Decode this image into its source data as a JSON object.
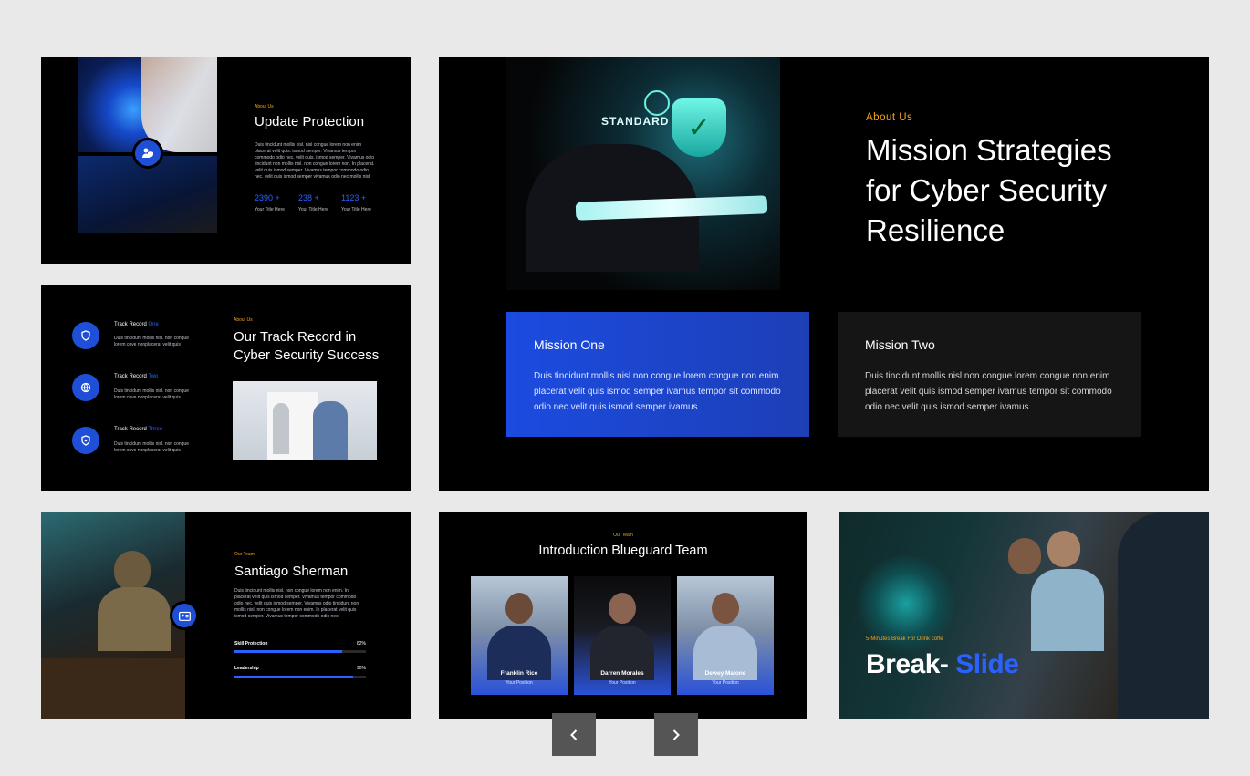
{
  "slide1": {
    "label": "About Us",
    "title": "Update Protection",
    "body": "Duis tincidunt mollis nisl. nisl congue lorem non enim placerat velit quis. ismod semper. Vivamus tempor commodo odio nec. velit quis. ismod semper. Vivamus odio tincidunt non mollis nisl. non congue lorem non. In placerat. velit quis ismod semper. Vivamus tempor commodo odio nec. velit quis ismod semper vivamus odio nec mollis nisl.",
    "stats": [
      {
        "value": "2390 +",
        "caption": "Your Title Here"
      },
      {
        "value": "238 +",
        "caption": "Your Title Here"
      },
      {
        "value": "1123 +",
        "caption": "Your Title Here"
      }
    ]
  },
  "slide2": {
    "label": "About Us",
    "title_line1": "Our Track Record in",
    "title_line2": "Cyber Security Success",
    "items": [
      {
        "name": "Track Record",
        "accent": "One",
        "body": "Duis tincidunt mollis nisl. non congue lorem cove nonplacerat velit quis"
      },
      {
        "name": "Track Record",
        "accent": "Two",
        "body": "Duis tincidunt mollis nisl. non congue lorem cove nonplacerat velit quis"
      },
      {
        "name": "Track Record",
        "accent": "Three",
        "body": "Duis tincidunt mollis nisl. non congue lorem cove nonplacerat velit quis"
      }
    ]
  },
  "slide3": {
    "label": "About Us",
    "title_line1": "Mission Strategies",
    "title_line2": "for Cyber Security",
    "title_line3": "Resilience",
    "image_text": "STANDARD",
    "missions": [
      {
        "title": "Mission One",
        "body": "Duis tincidunt mollis nisl non congue lorem congue non enim placerat velit quis ismod semper ivamus tempor sit commodo odio nec velit quis ismod semper ivamus"
      },
      {
        "title": "Mission Two",
        "body": "Duis tincidunt mollis nisl non congue lorem congue non enim placerat velit quis ismod semper ivamus tempor sit commodo odio nec velit quis ismod semper ivamus"
      }
    ]
  },
  "slide4": {
    "label": "Our Team",
    "name": "Santiago Sherman",
    "body": "Duis tincidunt mollis nisl. non congue lorem non enim. In placerat velit quis ismod semper. Vivamus tempor commodo odio nec. velit quis ismod semper. Vivamus odio tincidunt non mollis nisl. non congue lorem non enim. In placerat velit quis ismod semper. Vivamus tempor commodo odio nec.",
    "skills": [
      {
        "name": "Skill Protection",
        "value_text": "82%",
        "value": 0.82
      },
      {
        "name": "Leadership",
        "value_text": "90%",
        "value": 0.9
      }
    ]
  },
  "slide5": {
    "label": "Our Team",
    "title": "Introduction Blueguard Team",
    "members": [
      {
        "name": "Franklin Rice",
        "position": "Your Position"
      },
      {
        "name": "Darren Morales",
        "position": "Your Position"
      },
      {
        "name": "Dewey Malone",
        "position": "Your Position"
      }
    ]
  },
  "slide6": {
    "label": "5-Minutes Break For Drink coffe",
    "title_white": "Break-",
    "title_blue": "Slide"
  },
  "nav": {
    "prev": "‹",
    "next": "›"
  },
  "colors": {
    "accent_blue": "#2b62ff",
    "accent_orange": "#f2a51c",
    "background": "#e9e9e9"
  }
}
